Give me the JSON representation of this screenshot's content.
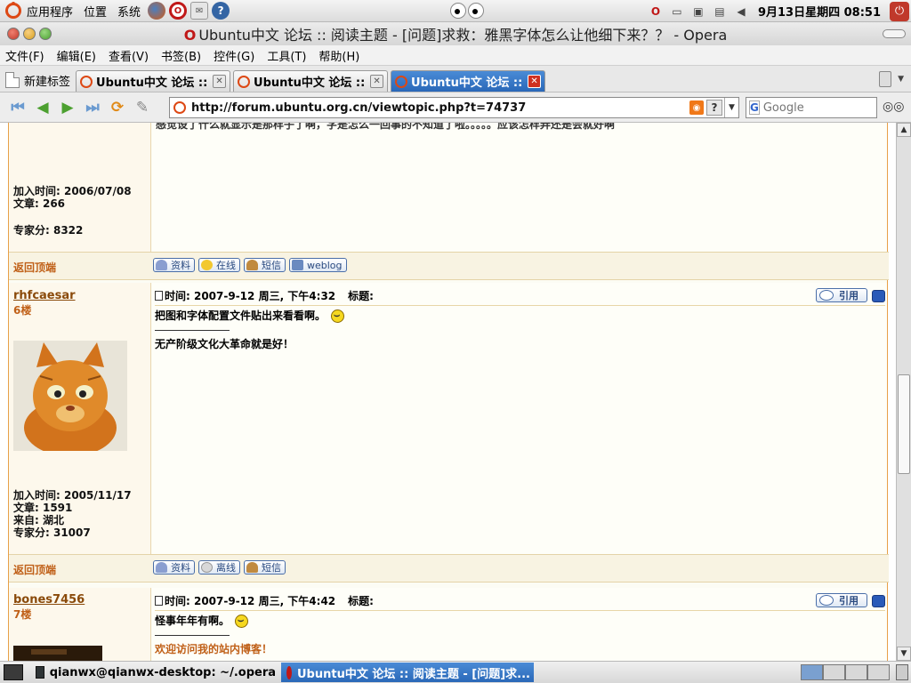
{
  "top_panel": {
    "menus": [
      "应用程序",
      "位置",
      "系统"
    ],
    "launchers": [
      "firefox-icon",
      "opera-icon",
      "mail-icon",
      "help-icon"
    ],
    "clock": "9月13日星期四 08:51"
  },
  "window": {
    "title": "Ubuntu中文 论坛 :: 阅读主题 - [问题]求救：雅黑字体怎么让他细下来？？ - Opera"
  },
  "menubar": [
    "文件(F)",
    "编辑(E)",
    "查看(V)",
    "书签(B)",
    "控件(G)",
    "工具(T)",
    "帮助(H)"
  ],
  "tabs": {
    "new_tab_label": "新建标签",
    "items": [
      {
        "title": "Ubuntu中文 论坛 :: ......",
        "active": false
      },
      {
        "title": "Ubuntu中文 论坛 :: ......",
        "active": false
      },
      {
        "title": "Ubuntu中文 论坛 :: ......",
        "active": true
      }
    ]
  },
  "address": {
    "url": "http://forum.ubuntu.org.cn/viewtopic.php?t=74737",
    "search_placeholder": "Google"
  },
  "forum": {
    "prev_post": {
      "cut_text": "感觉设了什么就显示是那样子了啊，字是怎么一回事的不知道了啦。。。。。应该怎样弄还是会就好啊",
      "joined": "加入时间: 2006/07/08",
      "posts": "文章: 266",
      "score": "专家分: 8322",
      "back_to_top": "返回顶端",
      "buttons": [
        "资料",
        "在线",
        "短信",
        "weblog"
      ]
    },
    "post6": {
      "username": "rhfcaesar",
      "floor": "6楼",
      "time": "时间: 2007-9-12 周三, 下午4:32",
      "subject_label": "标题:",
      "quote": "引用",
      "body": "把图和字体配置文件贴出来看看啊。",
      "signature": "无产阶级文化大革命就是好！",
      "joined": "加入时间: 2005/11/17",
      "posts": "文章: 1591",
      "location": "来自: 湖北",
      "score": "专家分: 31007",
      "back_to_top": "返回顶端",
      "buttons": [
        "资料",
        "离线",
        "短信"
      ]
    },
    "post7": {
      "username": "bones7456",
      "floor": "7楼",
      "time": "时间: 2007-9-12 周三, 下午4:42",
      "subject_label": "标题:",
      "quote": "引用",
      "body": "怪事年年有啊。",
      "signature": "欢迎访问我的站内博客！"
    }
  },
  "taskbar": {
    "tasks": [
      {
        "label": "qianwx@qianwx-desktop: ~/.opera",
        "active": false
      },
      {
        "label": "Ubuntu中文 论坛 :: 阅读主题 - [问题]求...",
        "active": true
      }
    ]
  },
  "colors": {
    "accent_orange": "#dd4814",
    "tab_active": "#2a68b8",
    "username": "#8a4a0a"
  }
}
